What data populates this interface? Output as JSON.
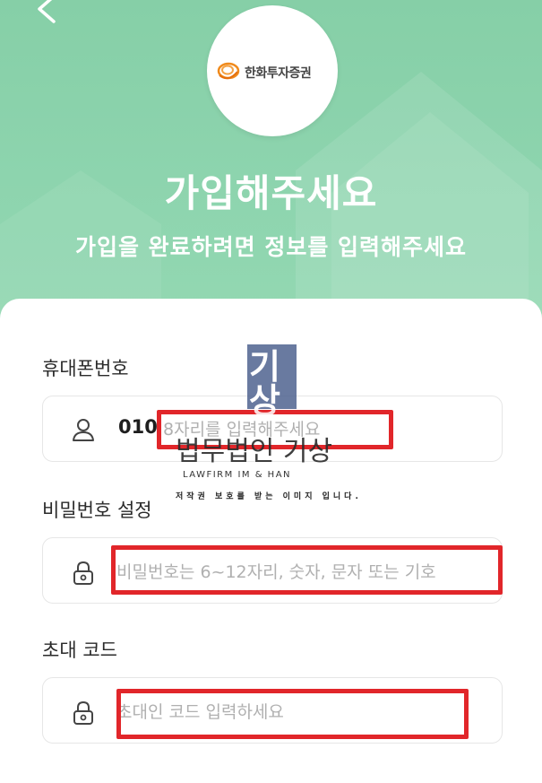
{
  "header": {
    "back_icon": "chevron-left-icon",
    "logo_text": "한화투자증권",
    "title": "가입해주세요",
    "subtitle": "가입을 완료하려면 정보를 입력해주세요"
  },
  "form": {
    "phone": {
      "label": "휴대폰번호",
      "icon": "user-icon",
      "prefix": "010",
      "placeholder": "8자리를 입력해주세요"
    },
    "password": {
      "label": "비밀번호 설정",
      "icon": "lock-icon",
      "placeholder": "비밀번호는 6~12자리, 숫자, 문자 또는 기호"
    },
    "invite": {
      "label": "초대 코드",
      "icon": "lock-icon",
      "placeholder": "초대인 코드 입력하세요"
    }
  },
  "watermark": {
    "block_text": "기상",
    "name": "법무법인 기상",
    "english": "LAWFIRM IM & HAN",
    "notice": "저작권 보호를 받는 이미지 입니다."
  },
  "colors": {
    "header_green": "#8fd3ad",
    "highlight_red": "#e1262a",
    "watermark_blue": "#4f6390"
  }
}
